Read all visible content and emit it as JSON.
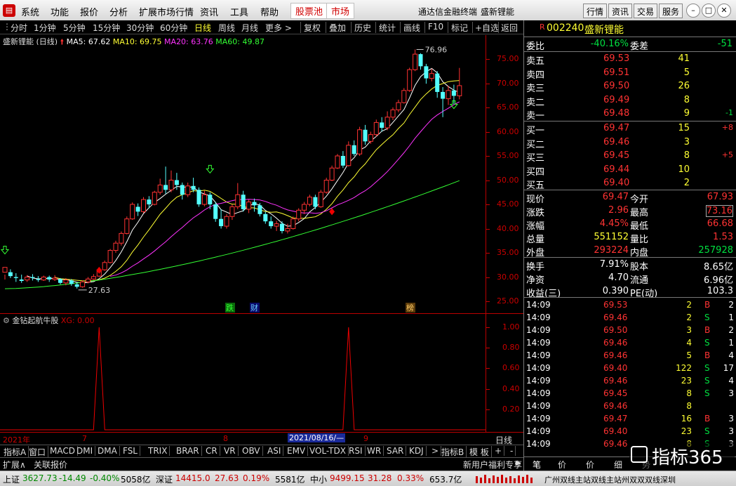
{
  "menu": {
    "items": [
      "系统",
      "功能",
      "报价",
      "分析",
      "扩展市场行情",
      "资讯",
      "工具",
      "帮助"
    ],
    "red_items": [
      "股票池",
      "市场"
    ],
    "app_title": "通达信金融终端",
    "stock_title": "盛新锂能",
    "right_buttons": [
      "行情",
      "资讯",
      "交易",
      "服务"
    ]
  },
  "toolbar": {
    "periods": [
      "分时",
      "1分钟",
      "5分钟",
      "15分钟",
      "30分钟",
      "60分钟",
      "日线",
      "周线",
      "月线",
      "更多 >"
    ],
    "tools": [
      "复权",
      "叠加",
      "历史",
      "统计",
      "画线",
      "F10",
      "标记",
      "+自选",
      "返回"
    ]
  },
  "chart": {
    "title": "盛新锂能 (日线)",
    "ma5": "MA5: 67.62",
    "ma10": "MA10: 69.75",
    "ma20": "MA20: 63.76",
    "ma60": "MA60: 49.87",
    "y_ticks": [
      "75.00",
      "70.00",
      "65.00",
      "60.00",
      "55.00",
      "50.00",
      "45.00",
      "40.00",
      "35.00",
      "30.00",
      "25.00"
    ],
    "high_label": "76.96",
    "low_label": "27.63",
    "events": [
      "跌",
      "财",
      "榜"
    ],
    "sub_title": "金钻起航牛股",
    "sub_value": "XG: 0.00",
    "sub_ticks": [
      "1.00",
      "0.80",
      "0.60",
      "0.40",
      "0.20"
    ],
    "x_labels": [
      "2021年",
      "7",
      "8",
      "2021/08/16/—",
      "9"
    ],
    "period_label": "日线"
  },
  "chart_data": [
    {
      "type": "candlestick",
      "ylim": [
        25,
        77
      ],
      "x_labels": [
        "2021年",
        "7",
        "8",
        "9"
      ],
      "y_ticks": [
        75,
        70,
        65,
        60,
        55,
        50,
        45,
        40,
        35,
        30,
        25
      ],
      "high": 76.96,
      "low": 27.63,
      "series": [
        {
          "name": "MA5",
          "value": 67.62
        },
        {
          "name": "MA10",
          "value": 69.75
        },
        {
          "name": "MA20",
          "value": 63.76
        },
        {
          "name": "MA60",
          "value": 49.87
        }
      ],
      "candles": [
        [
          31,
          32,
          30.5,
          29.5
        ],
        [
          31,
          30.2,
          31.6,
          29.8
        ],
        [
          30,
          29.8,
          30.8,
          29
        ],
        [
          29.5,
          29.2,
          30.5,
          28.8
        ],
        [
          29.4,
          30,
          30.4,
          29
        ],
        [
          30,
          29.8,
          30.6,
          29.3
        ],
        [
          29.6,
          29.4,
          30.2,
          29
        ],
        [
          29.4,
          30,
          30.3,
          29.2
        ],
        [
          30,
          29.5,
          30.3,
          29
        ],
        [
          29.5,
          29.8,
          30.4,
          29.2
        ],
        [
          29.6,
          28.8,
          29.8,
          28.5
        ],
        [
          28.8,
          29.4,
          29.8,
          28.3
        ],
        [
          29.3,
          28.6,
          29.6,
          28.2
        ],
        [
          28.5,
          28,
          28.9,
          27.63
        ],
        [
          28,
          29,
          29.3,
          27.8
        ],
        [
          29,
          29.6,
          30,
          28.7
        ],
        [
          29.6,
          30.1,
          30.6,
          29.4
        ],
        [
          30.2,
          31.5,
          31.8,
          30
        ],
        [
          31.5,
          33,
          33.4,
          31.3
        ],
        [
          33,
          35.5,
          35.8,
          32.8
        ],
        [
          35.5,
          37,
          37.5,
          35
        ],
        [
          37,
          39,
          39.4,
          36.5
        ],
        [
          39,
          42,
          42.5,
          38.8
        ],
        [
          42,
          45,
          45.4,
          41.8
        ],
        [
          44.5,
          43.5,
          45.2,
          42.6
        ],
        [
          43.5,
          46,
          46.5,
          43.2
        ],
        [
          46,
          45,
          46.7,
          44.2
        ],
        [
          45,
          47.5,
          47.8,
          44.8
        ],
        [
          47.5,
          49,
          50.3,
          47
        ],
        [
          49,
          48,
          52.8,
          47.2
        ],
        [
          48,
          50,
          52,
          47.5
        ],
        [
          50,
          49,
          51.5,
          48
        ],
        [
          49,
          47,
          49.5,
          46
        ],
        [
          47,
          48.8,
          49.5,
          46.5
        ],
        [
          48.8,
          48,
          50.5,
          47.5
        ],
        [
          48,
          45,
          48.5,
          44.5
        ],
        [
          45,
          47,
          47.8,
          44.6
        ],
        [
          47,
          45,
          47.5,
          44
        ],
        [
          45,
          42,
          45.5,
          41.4
        ],
        [
          42,
          40.5,
          44,
          40
        ],
        [
          40.5,
          42.5,
          43,
          40
        ],
        [
          42.5,
          44.5,
          45,
          41.8
        ],
        [
          44.5,
          47,
          49.4,
          44
        ],
        [
          47,
          44,
          47.8,
          43.5
        ],
        [
          44,
          45.5,
          46,
          43.2
        ],
        [
          45.5,
          44.8,
          46.2,
          43.5
        ],
        [
          44.8,
          43,
          45.3,
          42.5
        ],
        [
          43,
          41.5,
          43.5,
          41
        ],
        [
          41.5,
          40.5,
          42.5,
          40
        ],
        [
          40.5,
          41,
          41.6,
          39.5
        ],
        [
          41,
          39.5,
          41.5,
          39
        ],
        [
          39.5,
          40,
          41,
          39
        ],
        [
          40,
          42,
          42.5,
          39.8
        ],
        [
          42,
          43.8,
          44.2,
          41.5
        ],
        [
          43.8,
          45,
          45.5,
          43
        ],
        [
          45,
          46.5,
          47,
          44.6
        ],
        [
          46.5,
          44.5,
          47,
          44
        ],
        [
          44.5,
          47.5,
          48,
          44.3
        ],
        [
          47.5,
          50,
          50.5,
          47.2
        ],
        [
          50,
          52.5,
          53,
          49.8
        ],
        [
          52.5,
          55,
          55.4,
          52.3
        ],
        [
          55,
          53,
          56,
          52.5
        ],
        [
          53,
          57.2,
          58,
          52.8
        ],
        [
          57.2,
          55.4,
          58.2,
          55
        ],
        [
          55.4,
          60.4,
          61,
          55
        ],
        [
          60.4,
          58,
          61.4,
          57.3
        ],
        [
          58,
          59.4,
          60,
          57.5
        ],
        [
          59.4,
          61.9,
          62.5,
          59
        ],
        [
          61.9,
          60.8,
          63,
          60
        ],
        [
          60.8,
          63,
          64.2,
          60.3
        ],
        [
          63,
          64.5,
          65,
          62.4
        ],
        [
          64.5,
          66,
          66.6,
          64
        ],
        [
          66,
          68.5,
          69,
          65.8
        ],
        [
          68.5,
          72.8,
          73.2,
          68.2
        ],
        [
          72.8,
          76,
          76.96,
          72.5
        ],
        [
          76,
          73.5,
          76.2,
          72.8
        ],
        [
          73.5,
          71,
          74,
          69.9
        ],
        [
          71,
          72,
          73,
          70.4
        ],
        [
          72,
          68.2,
          72.5,
          67
        ],
        [
          68.2,
          66.8,
          69.2,
          63
        ],
        [
          66.8,
          68.5,
          69.5,
          65.5
        ],
        [
          68.5,
          67.4,
          69.7,
          65.7
        ],
        [
          67.4,
          69.5,
          73.16,
          66.68
        ]
      ]
    },
    {
      "type": "line",
      "title": "金钻起航牛股",
      "ylim": [
        0,
        1.1
      ],
      "y_ticks": [
        1.0,
        0.8,
        0.6,
        0.4,
        0.2
      ],
      "xg_signals_at": [
        17,
        62
      ],
      "value": 0.0
    }
  ],
  "bottom_tabs": [
    "指标A",
    "窗口",
    "MACD",
    "DMI",
    "DMA",
    "FSL",
    "TRIX",
    "BRAR",
    "CR",
    "VR",
    "OBV",
    "ASI",
    "EMV",
    "VOL-TDX",
    "RSI",
    "WR",
    "SAR",
    "KDJ",
    ">",
    "指标B",
    "模 板",
    "+",
    "-"
  ],
  "bottom2": {
    "left": "扩展∧",
    "item": "关联报价",
    "right": "新用户福利专享",
    "arrow": "▶"
  },
  "quote": {
    "code_tag": "R",
    "code": "002240",
    "name": "盛新锂能",
    "weibi_label": "委比",
    "weibi": "-40.16%",
    "weicha_label": "委差",
    "weicha": "-51",
    "asks": [
      {
        "label": "卖五",
        "price": "69.53",
        "vol": "41",
        "chg": ""
      },
      {
        "label": "卖四",
        "price": "69.51",
        "vol": "5",
        "chg": ""
      },
      {
        "label": "卖三",
        "price": "69.50",
        "vol": "26",
        "chg": ""
      },
      {
        "label": "卖二",
        "price": "69.49",
        "vol": "8",
        "chg": ""
      },
      {
        "label": "卖一",
        "price": "69.48",
        "vol": "9",
        "chg": "-1"
      }
    ],
    "bids": [
      {
        "label": "买一",
        "price": "69.47",
        "vol": "15",
        "chg": "+8"
      },
      {
        "label": "买二",
        "price": "69.46",
        "vol": "3",
        "chg": ""
      },
      {
        "label": "买三",
        "price": "69.45",
        "vol": "8",
        "chg": "+5"
      },
      {
        "label": "买四",
        "price": "69.44",
        "vol": "10",
        "chg": ""
      },
      {
        "label": "买五",
        "price": "69.40",
        "vol": "2",
        "chg": ""
      }
    ],
    "stats": [
      [
        "现价",
        "69.47",
        "今开",
        "67.93"
      ],
      [
        "涨跌",
        "2.96",
        "最高",
        "73.16"
      ],
      [
        "涨幅",
        "4.45%",
        "最低",
        "66.68"
      ],
      [
        "总量",
        "551152",
        "量比",
        "1.53"
      ],
      [
        "外盘",
        "293224",
        "内盘",
        "257928"
      ]
    ],
    "stats2": [
      [
        "换手",
        "7.91%",
        "股本",
        "8.65亿"
      ],
      [
        "净资",
        "4.70",
        "流通",
        "6.96亿"
      ],
      [
        "收益(三)",
        "0.390",
        "PE(动)",
        "103.3"
      ]
    ],
    "ticks": [
      [
        "14:09",
        "69.53",
        "2",
        "B",
        "2"
      ],
      [
        "14:09",
        "69.46",
        "2",
        "S",
        "1"
      ],
      [
        "14:09",
        "69.50",
        "3",
        "B",
        "2"
      ],
      [
        "14:09",
        "69.46",
        "4",
        "S",
        "1"
      ],
      [
        "14:09",
        "69.46",
        "5",
        "B",
        "4"
      ],
      [
        "14:09",
        "69.40",
        "122",
        "S",
        "17"
      ],
      [
        "14:09",
        "69.46",
        "23",
        "S",
        "4"
      ],
      [
        "14:09",
        "69.45",
        "8",
        "S",
        "3"
      ],
      [
        "14:09",
        "69.46",
        "8",
        "",
        ""
      ],
      [
        "14:09",
        "69.47",
        "16",
        "B",
        "3"
      ],
      [
        "14:09",
        "69.40",
        "23",
        "S",
        "3"
      ],
      [
        "14:09",
        "69.46",
        "8",
        "S",
        "3"
      ]
    ],
    "tabs": [
      "笔",
      "价",
      "价",
      "细",
      "势"
    ]
  },
  "status": {
    "sh_label": "上证",
    "sh_val": "3627.73",
    "sh_chg": "-14.49",
    "sh_pct": "-0.40%",
    "sh_amt": "5058亿",
    "sz_label": "深证",
    "sz_val": "14415.0",
    "sz_chg": "27.63",
    "sz_pct": "0.19%",
    "sz_amt": "5581亿",
    "zx_label": "中小",
    "zx_val": "9499.15",
    "zx_chg": "31.28",
    "zx_pct": "0.33%",
    "zx_amt": "653.7亿",
    "ticker": "广州双线主站双线主站州双双双线深圳",
    "logo": "指标365"
  }
}
